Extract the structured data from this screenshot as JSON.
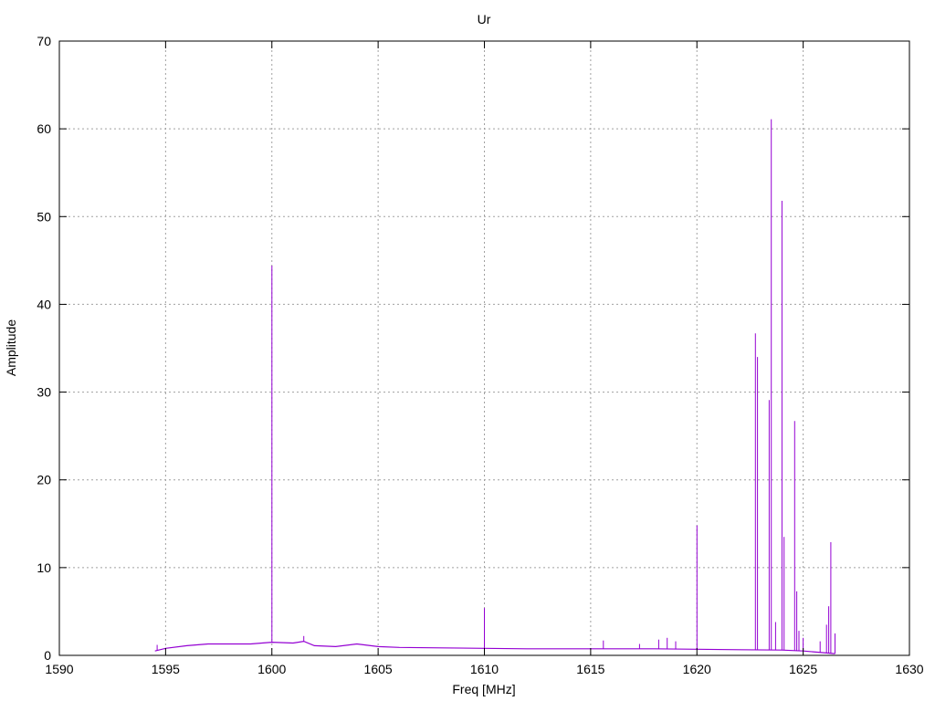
{
  "chart_data": {
    "type": "line",
    "title": "Ur",
    "xlabel": "Freq [MHz]",
    "ylabel": "Amplitude",
    "xlim": [
      1590,
      1630
    ],
    "ylim": [
      0,
      70
    ],
    "xticks": [
      1590,
      1595,
      1600,
      1605,
      1610,
      1615,
      1620,
      1625,
      1630
    ],
    "yticks": [
      0,
      10,
      20,
      30,
      40,
      50,
      60,
      70
    ],
    "grid": true,
    "legend": "none",
    "series": [
      {
        "color": "#9400d3",
        "baseline": [
          [
            1594.5,
            0.5
          ],
          [
            1595.0,
            0.8
          ],
          [
            1596.0,
            1.1
          ],
          [
            1597.0,
            1.3
          ],
          [
            1598.0,
            1.3
          ],
          [
            1599.0,
            1.3
          ],
          [
            1600.0,
            1.5
          ],
          [
            1601.0,
            1.4
          ],
          [
            1601.5,
            1.6
          ],
          [
            1602.0,
            1.1
          ],
          [
            1603.0,
            1.0
          ],
          [
            1604.0,
            1.3
          ],
          [
            1605.0,
            1.0
          ],
          [
            1606.0,
            0.9
          ],
          [
            1608.0,
            0.85
          ],
          [
            1610.0,
            0.8
          ],
          [
            1612.0,
            0.75
          ],
          [
            1615.0,
            0.75
          ],
          [
            1618.0,
            0.75
          ],
          [
            1620.0,
            0.7
          ],
          [
            1622.0,
            0.65
          ],
          [
            1624.0,
            0.6
          ],
          [
            1625.0,
            0.5
          ],
          [
            1626.5,
            0.2
          ]
        ],
        "spikes": [
          [
            1594.6,
            1.2
          ],
          [
            1600.0,
            44.4
          ],
          [
            1601.5,
            2.2
          ],
          [
            1610.0,
            5.4
          ],
          [
            1615.6,
            1.7
          ],
          [
            1617.3,
            1.3
          ],
          [
            1618.2,
            1.8
          ],
          [
            1618.6,
            2.0
          ],
          [
            1619.0,
            1.6
          ],
          [
            1620.0,
            14.8
          ],
          [
            1622.75,
            36.7
          ],
          [
            1622.85,
            34.0
          ],
          [
            1623.4,
            29.1
          ],
          [
            1623.5,
            61.1
          ],
          [
            1623.7,
            3.8
          ],
          [
            1624.0,
            51.8
          ],
          [
            1624.1,
            13.5
          ],
          [
            1624.6,
            26.7
          ],
          [
            1624.7,
            7.3
          ],
          [
            1624.8,
            2.8
          ],
          [
            1625.0,
            2.0
          ],
          [
            1625.8,
            1.6
          ],
          [
            1626.1,
            3.5
          ],
          [
            1626.2,
            5.6
          ],
          [
            1626.3,
            12.9
          ],
          [
            1626.5,
            2.5
          ]
        ]
      }
    ]
  }
}
